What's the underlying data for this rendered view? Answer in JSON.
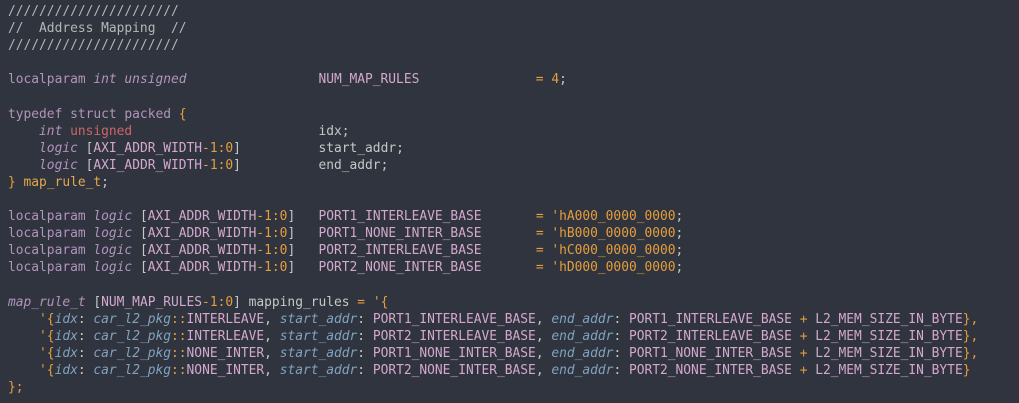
{
  "theme": {
    "background": "#2f343f",
    "comment": "#b4b7b4",
    "keyword": "#b294bb",
    "type_red": "#cc6666",
    "identifier": "#d3a8cc",
    "number": "#e69d3c",
    "package": "#81a2be"
  },
  "lines": [
    [
      {
        "t": "//////////////////////",
        "c": "comment"
      }
    ],
    [
      {
        "t": "//  Address Mapping  //",
        "c": "comment"
      }
    ],
    [
      {
        "t": "//////////////////////",
        "c": "comment"
      }
    ],
    [],
    [
      {
        "t": "localparam",
        "c": "kw"
      },
      {
        "t": " ",
        "c": "plain"
      },
      {
        "t": "int unsigned",
        "c": "type"
      },
      {
        "t": "                 ",
        "c": "plain"
      },
      {
        "t": "NUM_MAP_RULES",
        "c": "ident"
      },
      {
        "t": "               ",
        "c": "plain"
      },
      {
        "t": "=",
        "c": "op"
      },
      {
        "t": " ",
        "c": "plain"
      },
      {
        "t": "4",
        "c": "num"
      },
      {
        "t": ";",
        "c": "plain"
      }
    ],
    [],
    [
      {
        "t": "typedef struct packed",
        "c": "kw"
      },
      {
        "t": " ",
        "c": "plain"
      },
      {
        "t": "{",
        "c": "brace"
      }
    ],
    [
      {
        "t": "    ",
        "c": "plain"
      },
      {
        "t": "int",
        "c": "type"
      },
      {
        "t": " ",
        "c": "plain"
      },
      {
        "t": "unsigned",
        "c": "type-red"
      },
      {
        "t": "                        ",
        "c": "plain"
      },
      {
        "t": "idx;",
        "c": "plain"
      }
    ],
    [
      {
        "t": "    ",
        "c": "plain"
      },
      {
        "t": "logic",
        "c": "type"
      },
      {
        "t": " [",
        "c": "plain"
      },
      {
        "t": "AXI_ADDR_WIDTH",
        "c": "ident"
      },
      {
        "t": "-",
        "c": "op"
      },
      {
        "t": "1",
        "c": "num"
      },
      {
        "t": ":",
        "c": "op"
      },
      {
        "t": "0",
        "c": "num"
      },
      {
        "t": "]",
        "c": "plain"
      },
      {
        "t": "          ",
        "c": "plain"
      },
      {
        "t": "start_addr;",
        "c": "plain"
      }
    ],
    [
      {
        "t": "    ",
        "c": "plain"
      },
      {
        "t": "logic",
        "c": "type"
      },
      {
        "t": " [",
        "c": "plain"
      },
      {
        "t": "AXI_ADDR_WIDTH",
        "c": "ident"
      },
      {
        "t": "-",
        "c": "op"
      },
      {
        "t": "1",
        "c": "num"
      },
      {
        "t": ":",
        "c": "op"
      },
      {
        "t": "0",
        "c": "num"
      },
      {
        "t": "]",
        "c": "plain"
      },
      {
        "t": "          ",
        "c": "plain"
      },
      {
        "t": "end_addr;",
        "c": "plain"
      }
    ],
    [
      {
        "t": "}",
        "c": "brace"
      },
      {
        "t": " ",
        "c": "plain"
      },
      {
        "t": "map_rule_t",
        "c": "struct-name"
      },
      {
        "t": ";",
        "c": "plain"
      }
    ],
    [],
    [
      {
        "t": "localparam",
        "c": "kw"
      },
      {
        "t": " ",
        "c": "plain"
      },
      {
        "t": "logic",
        "c": "type"
      },
      {
        "t": " [",
        "c": "plain"
      },
      {
        "t": "AXI_ADDR_WIDTH",
        "c": "ident"
      },
      {
        "t": "-",
        "c": "op"
      },
      {
        "t": "1",
        "c": "num"
      },
      {
        "t": ":",
        "c": "op"
      },
      {
        "t": "0",
        "c": "num"
      },
      {
        "t": "]",
        "c": "plain"
      },
      {
        "t": "   ",
        "c": "plain"
      },
      {
        "t": "PORT1_INTERLEAVE_BASE",
        "c": "ident"
      },
      {
        "t": "       ",
        "c": "plain"
      },
      {
        "t": "=",
        "c": "op"
      },
      {
        "t": " ",
        "c": "plain"
      },
      {
        "t": "'hA000_0000_0000",
        "c": "num"
      },
      {
        "t": ";",
        "c": "plain"
      }
    ],
    [
      {
        "t": "localparam",
        "c": "kw"
      },
      {
        "t": " ",
        "c": "plain"
      },
      {
        "t": "logic",
        "c": "type"
      },
      {
        "t": " [",
        "c": "plain"
      },
      {
        "t": "AXI_ADDR_WIDTH",
        "c": "ident"
      },
      {
        "t": "-",
        "c": "op"
      },
      {
        "t": "1",
        "c": "num"
      },
      {
        "t": ":",
        "c": "op"
      },
      {
        "t": "0",
        "c": "num"
      },
      {
        "t": "]",
        "c": "plain"
      },
      {
        "t": "   ",
        "c": "plain"
      },
      {
        "t": "PORT1_NONE_INTER_BASE",
        "c": "ident"
      },
      {
        "t": "       ",
        "c": "plain"
      },
      {
        "t": "=",
        "c": "op"
      },
      {
        "t": " ",
        "c": "plain"
      },
      {
        "t": "'hB000_0000_0000",
        "c": "num"
      },
      {
        "t": ";",
        "c": "plain"
      }
    ],
    [
      {
        "t": "localparam",
        "c": "kw"
      },
      {
        "t": " ",
        "c": "plain"
      },
      {
        "t": "logic",
        "c": "type"
      },
      {
        "t": " [",
        "c": "plain"
      },
      {
        "t": "AXI_ADDR_WIDTH",
        "c": "ident"
      },
      {
        "t": "-",
        "c": "op"
      },
      {
        "t": "1",
        "c": "num"
      },
      {
        "t": ":",
        "c": "op"
      },
      {
        "t": "0",
        "c": "num"
      },
      {
        "t": "]",
        "c": "plain"
      },
      {
        "t": "   ",
        "c": "plain"
      },
      {
        "t": "PORT2_INTERLEAVE_BASE",
        "c": "ident"
      },
      {
        "t": "       ",
        "c": "plain"
      },
      {
        "t": "=",
        "c": "op"
      },
      {
        "t": " ",
        "c": "plain"
      },
      {
        "t": "'hC000_0000_0000",
        "c": "num"
      },
      {
        "t": ";",
        "c": "plain"
      }
    ],
    [
      {
        "t": "localparam",
        "c": "kw"
      },
      {
        "t": " ",
        "c": "plain"
      },
      {
        "t": "logic",
        "c": "type"
      },
      {
        "t": " [",
        "c": "plain"
      },
      {
        "t": "AXI_ADDR_WIDTH",
        "c": "ident"
      },
      {
        "t": "-",
        "c": "op"
      },
      {
        "t": "1",
        "c": "num"
      },
      {
        "t": ":",
        "c": "op"
      },
      {
        "t": "0",
        "c": "num"
      },
      {
        "t": "]",
        "c": "plain"
      },
      {
        "t": "   ",
        "c": "plain"
      },
      {
        "t": "PORT2_NONE_INTER_BASE",
        "c": "ident"
      },
      {
        "t": "       ",
        "c": "plain"
      },
      {
        "t": "=",
        "c": "op"
      },
      {
        "t": " ",
        "c": "plain"
      },
      {
        "t": "'hD000_0000_0000",
        "c": "num"
      },
      {
        "t": ";",
        "c": "plain"
      }
    ],
    [],
    [
      {
        "t": "map_rule_t",
        "c": "type"
      },
      {
        "t": " [",
        "c": "plain"
      },
      {
        "t": "NUM_MAP_RULES",
        "c": "ident"
      },
      {
        "t": "-",
        "c": "op"
      },
      {
        "t": "1",
        "c": "num"
      },
      {
        "t": ":",
        "c": "op"
      },
      {
        "t": "0",
        "c": "num"
      },
      {
        "t": "] mapping_rules ",
        "c": "plain"
      },
      {
        "t": "=",
        "c": "op"
      },
      {
        "t": " ",
        "c": "plain"
      },
      {
        "t": "'{",
        "c": "brace"
      }
    ],
    [
      {
        "t": "    ",
        "c": "plain"
      },
      {
        "t": "'{",
        "c": "brace"
      },
      {
        "t": "idx",
        "c": "field"
      },
      {
        "t": ": ",
        "c": "sep"
      },
      {
        "t": "car_l2_pkg",
        "c": "pkg"
      },
      {
        "t": "::",
        "c": "op"
      },
      {
        "t": "INTERLEAVE",
        "c": "ident"
      },
      {
        "t": ", ",
        "c": "sep"
      },
      {
        "t": "start_addr",
        "c": "field"
      },
      {
        "t": ": ",
        "c": "sep"
      },
      {
        "t": "PORT1_INTERLEAVE_BASE",
        "c": "ident"
      },
      {
        "t": ", ",
        "c": "sep"
      },
      {
        "t": "end_addr",
        "c": "field"
      },
      {
        "t": ": ",
        "c": "sep"
      },
      {
        "t": "PORT1_INTERLEAVE_BASE",
        "c": "ident"
      },
      {
        "t": " ",
        "c": "plain"
      },
      {
        "t": "+",
        "c": "op"
      },
      {
        "t": " ",
        "c": "plain"
      },
      {
        "t": "L2_MEM_SIZE_IN_BYTE",
        "c": "ident"
      },
      {
        "t": "},",
        "c": "brace"
      }
    ],
    [
      {
        "t": "    ",
        "c": "plain"
      },
      {
        "t": "'{",
        "c": "brace"
      },
      {
        "t": "idx",
        "c": "field"
      },
      {
        "t": ": ",
        "c": "sep"
      },
      {
        "t": "car_l2_pkg",
        "c": "pkg"
      },
      {
        "t": "::",
        "c": "op"
      },
      {
        "t": "INTERLEAVE",
        "c": "ident"
      },
      {
        "t": ", ",
        "c": "sep"
      },
      {
        "t": "start_addr",
        "c": "field"
      },
      {
        "t": ": ",
        "c": "sep"
      },
      {
        "t": "PORT2_INTERLEAVE_BASE",
        "c": "ident"
      },
      {
        "t": ", ",
        "c": "sep"
      },
      {
        "t": "end_addr",
        "c": "field"
      },
      {
        "t": ": ",
        "c": "sep"
      },
      {
        "t": "PORT2_INTERLEAVE_BASE",
        "c": "ident"
      },
      {
        "t": " ",
        "c": "plain"
      },
      {
        "t": "+",
        "c": "op"
      },
      {
        "t": " ",
        "c": "plain"
      },
      {
        "t": "L2_MEM_SIZE_IN_BYTE",
        "c": "ident"
      },
      {
        "t": "},",
        "c": "brace"
      }
    ],
    [
      {
        "t": "    ",
        "c": "plain"
      },
      {
        "t": "'{",
        "c": "brace"
      },
      {
        "t": "idx",
        "c": "field"
      },
      {
        "t": ": ",
        "c": "sep"
      },
      {
        "t": "car_l2_pkg",
        "c": "pkg"
      },
      {
        "t": "::",
        "c": "op"
      },
      {
        "t": "NONE_INTER",
        "c": "ident"
      },
      {
        "t": ", ",
        "c": "sep"
      },
      {
        "t": "start_addr",
        "c": "field"
      },
      {
        "t": ": ",
        "c": "sep"
      },
      {
        "t": "PORT1_NONE_INTER_BASE",
        "c": "ident"
      },
      {
        "t": ", ",
        "c": "sep"
      },
      {
        "t": "end_addr",
        "c": "field"
      },
      {
        "t": ": ",
        "c": "sep"
      },
      {
        "t": "PORT1_NONE_INTER_BASE",
        "c": "ident"
      },
      {
        "t": " ",
        "c": "plain"
      },
      {
        "t": "+",
        "c": "op"
      },
      {
        "t": " ",
        "c": "plain"
      },
      {
        "t": "L2_MEM_SIZE_IN_BYTE",
        "c": "ident"
      },
      {
        "t": "},",
        "c": "brace"
      }
    ],
    [
      {
        "t": "    ",
        "c": "plain"
      },
      {
        "t": "'{",
        "c": "brace"
      },
      {
        "t": "idx",
        "c": "field"
      },
      {
        "t": ": ",
        "c": "sep"
      },
      {
        "t": "car_l2_pkg",
        "c": "pkg"
      },
      {
        "t": "::",
        "c": "op"
      },
      {
        "t": "NONE_INTER",
        "c": "ident"
      },
      {
        "t": ", ",
        "c": "sep"
      },
      {
        "t": "start_addr",
        "c": "field"
      },
      {
        "t": ": ",
        "c": "sep"
      },
      {
        "t": "PORT2_NONE_INTER_BASE",
        "c": "ident"
      },
      {
        "t": ", ",
        "c": "sep"
      },
      {
        "t": "end_addr",
        "c": "field"
      },
      {
        "t": ": ",
        "c": "sep"
      },
      {
        "t": "PORT2_NONE_INTER_BASE",
        "c": "ident"
      },
      {
        "t": " ",
        "c": "plain"
      },
      {
        "t": "+",
        "c": "op"
      },
      {
        "t": " ",
        "c": "plain"
      },
      {
        "t": "L2_MEM_SIZE_IN_BYTE",
        "c": "ident"
      },
      {
        "t": "}",
        "c": "brace"
      }
    ],
    [
      {
        "t": "};",
        "c": "brace"
      }
    ]
  ]
}
